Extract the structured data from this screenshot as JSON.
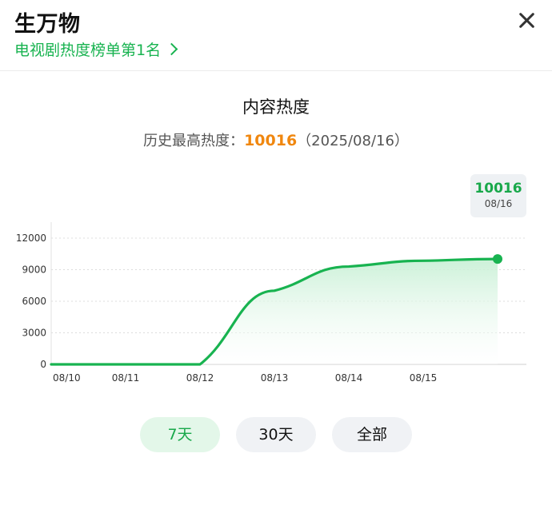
{
  "header": {
    "title": "生万物",
    "rank_link": "电视剧热度榜单第1名",
    "close_icon": "close-icon"
  },
  "section": {
    "title": "内容热度",
    "peak_label": "历史最高热度：",
    "peak_value": "10016",
    "peak_date": "（2025/08/16）"
  },
  "tooltip": {
    "value": "10016",
    "date": "08/16"
  },
  "range_buttons": [
    {
      "label": "7天",
      "active": true
    },
    {
      "label": "30天",
      "active": false
    },
    {
      "label": "全部",
      "active": false
    }
  ],
  "colors": {
    "accent_green": "#18b350",
    "peak_orange": "#f0870f",
    "area_fill": "#e6f8ec"
  },
  "chart_data": {
    "type": "area",
    "x": [
      "08/10",
      "08/11",
      "08/12",
      "08/13",
      "08/14",
      "08/15",
      "08/16"
    ],
    "values": [
      0,
      0,
      0,
      7000,
      9300,
      9850,
      10016
    ],
    "y_ticks": [
      0,
      3000,
      6000,
      9000,
      12000
    ],
    "ylim": [
      0,
      12000
    ],
    "grid": true,
    "highlighted_point": {
      "x": "08/16",
      "value": 10016
    }
  }
}
